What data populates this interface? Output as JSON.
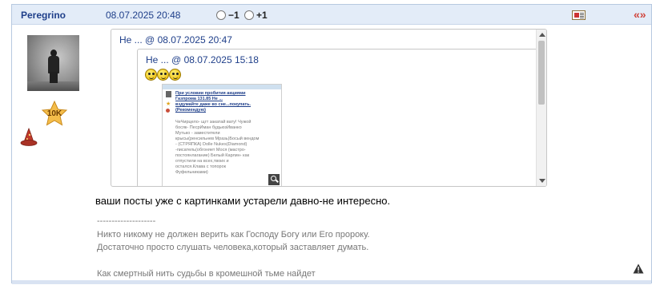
{
  "post": {
    "author": "Peregrino",
    "date": "08.07.2025 20:48",
    "vote_minus": "−1",
    "vote_plus": "+1",
    "quote_icon": "«»",
    "reply_icon": "reply-icon",
    "badge_label": "10K",
    "message": "ваши посты уже с картинками устарели давно-не интересно.",
    "signature": {
      "separator": "--------------------",
      "line1": "Никто никому не должен верить как Господу Богу или Его пророку.",
      "line2": "Достаточно просто слушать человека,который заставляет думать.",
      "line3": "",
      "line4": "Как смертный нить судьбы в кромешной тьме найдет"
    }
  },
  "outer_quote": {
    "author": "Не ...",
    "at": "@",
    "date": "08.07.2025 20:47"
  },
  "inner_quote": {
    "author": "Не ...",
    "at": "@",
    "date": "08.07.2025 15:18"
  },
  "thumbnail": {
    "link_lines": [
      "При условии пробития акциями",
      "Газпрома 131.85 Не ...",
      "вздумайте даже во сне...покупать.",
      "(Рекомендую)"
    ],
    "text_lines": [
      "ЧеЧирцело- щгт закатай вату! Чужой",
      "босяк- ПесрИман будьюзИванко",
      "Мутько - заместители",
      "крысы(ренсильнев Мразь)Босый вендом",
      "- (СТРЯПКА) Dolle Nukes(Diamond)",
      "-писатель(обгоняет Мося (мастро-",
      "постоянлагание) Белый Карлин- как",
      "отпустили на всех,твоих и",
      "остался.Клава с топорок",
      "Фуфельниками)"
    ]
  },
  "colors": {
    "header_bg": "#e3ecf8",
    "link": "#1f3f8a",
    "quote_accent": "#d0453c"
  }
}
